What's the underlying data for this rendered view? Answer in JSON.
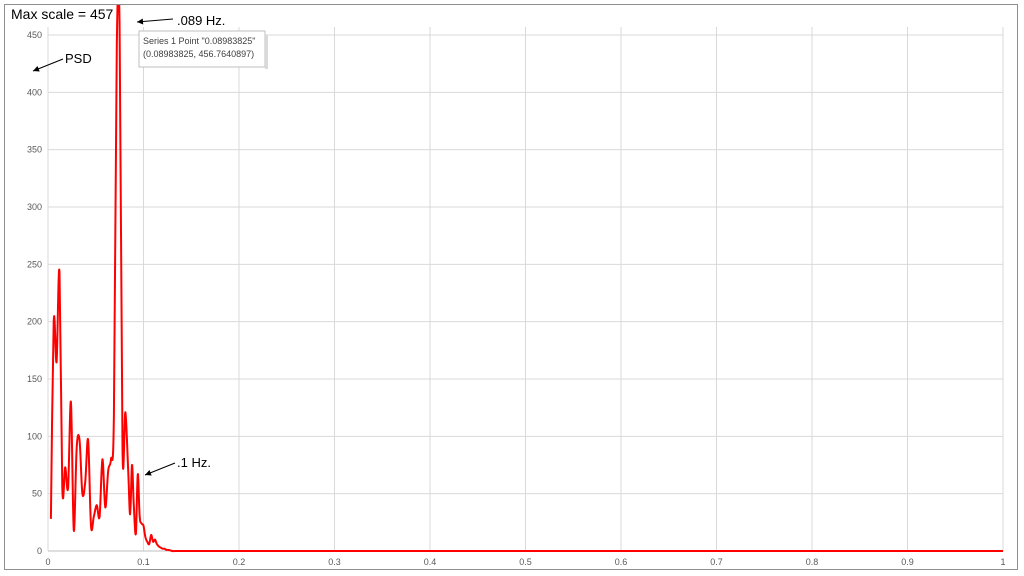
{
  "chart_data": {
    "type": "line",
    "xlim": [
      0,
      1
    ],
    "ylim": [
      0,
      457
    ],
    "x_ticks": [
      "0",
      "0.1",
      "0.2",
      "0.3",
      "0.4",
      "0.5",
      "0.6",
      "0.7",
      "0.8",
      "0.9",
      "1"
    ],
    "y_ticks": [
      "0",
      "50",
      "100",
      "150",
      "200",
      "250",
      "300",
      "350",
      "400",
      "450"
    ],
    "grid": true,
    "line_color": "#ff0000",
    "series": [
      {
        "x": [
          0.003,
          0.006,
          0.009,
          0.012,
          0.015,
          0.018,
          0.021,
          0.024,
          0.027,
          0.03,
          0.033,
          0.036,
          0.039,
          0.042,
          0.045,
          0.048,
          0.051,
          0.054,
          0.057,
          0.06,
          0.063,
          0.066,
          0.069,
          0.072,
          0.075,
          0.078,
          0.081,
          0.084,
          0.086,
          0.088,
          0.0898,
          0.092,
          0.094,
          0.096,
          0.098,
          0.1,
          0.102,
          0.104,
          0.106,
          0.108,
          0.11,
          0.112,
          0.114,
          0.116,
          0.118,
          0.12,
          0.122,
          0.124,
          0.126,
          0.13,
          0.135,
          0.14,
          0.145,
          0.15,
          0.155,
          0.16,
          0.165,
          0.17,
          0.175,
          0.18,
          0.185,
          0.19,
          0.195,
          0.2,
          0.21,
          0.22,
          0.23,
          0.24,
          0.25,
          0.3,
          0.4,
          0.5,
          0.6,
          0.65,
          0.7,
          0.72,
          0.74,
          0.76,
          0.8,
          0.85,
          0.9,
          0.95,
          0.98,
          1.0
        ],
        "y": [
          28,
          200,
          165,
          243,
          55,
          73,
          55,
          130,
          18,
          90,
          97,
          50,
          60,
          97,
          22,
          30,
          40,
          30,
          80,
          38,
          70,
          80,
          118,
          440,
          457,
          90,
          121,
          70,
          32,
          75,
          40,
          15,
          67,
          30,
          24,
          22,
          12,
          8,
          6,
          14,
          8,
          10,
          6,
          4,
          3,
          2,
          2,
          1,
          1,
          0,
          0,
          0,
          0,
          0,
          0,
          0,
          0,
          0,
          0,
          0,
          0,
          0,
          0,
          0,
          0,
          0,
          0,
          0,
          0,
          0,
          0,
          0,
          0,
          0,
          0,
          0,
          0,
          0,
          0,
          0,
          0,
          0,
          0,
          0
        ]
      }
    ],
    "annotations": {
      "max_scale": "Max scale = 457",
      "peak": ".089 Hz.",
      "psd": "PSD",
      "second": ".1 Hz."
    },
    "tooltip": {
      "line1": "Series 1 Point \"0.08983825\"",
      "line2": "(0.08983825, 456.7640897)"
    }
  }
}
